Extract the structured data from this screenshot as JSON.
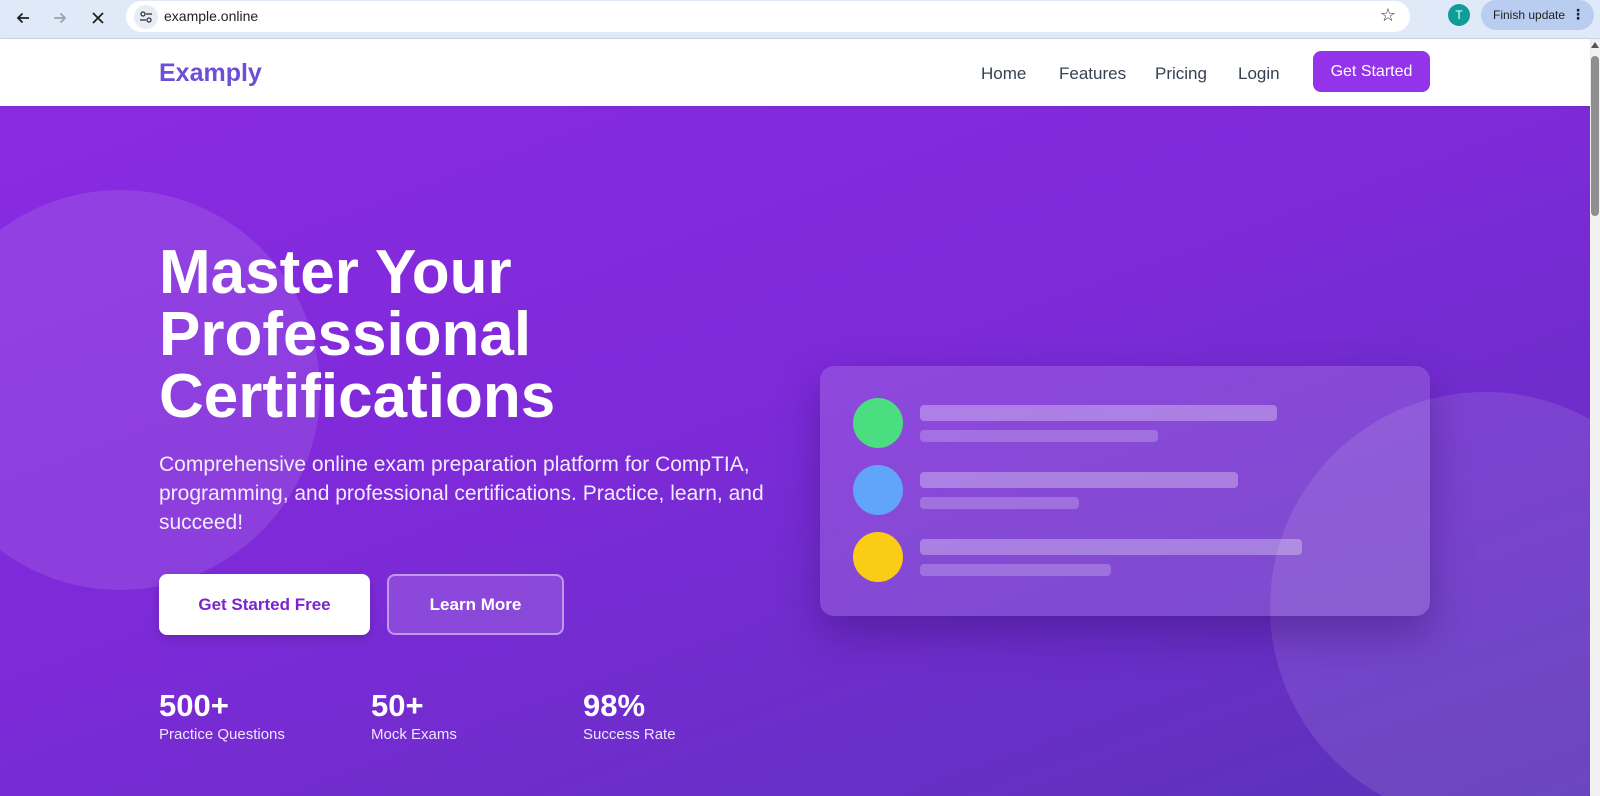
{
  "browser": {
    "url": "example.online",
    "profile_initial": "T",
    "update_label": "Finish update",
    "icons": [
      "back-arrow-icon",
      "forward-arrow-icon",
      "close-icon",
      "site-info-icon",
      "star-icon",
      "more-vert-icon"
    ]
  },
  "header": {
    "brand": "Examply",
    "nav": [
      {
        "label": "Home"
      },
      {
        "label": "Features"
      },
      {
        "label": "Pricing"
      },
      {
        "label": "Login"
      }
    ],
    "cta_label": "Get Started",
    "colors": {
      "brand": "#6b4fd6",
      "accent": "#9333ea"
    }
  },
  "hero": {
    "title_lines": [
      "Master Your",
      "Professional",
      "Certifications"
    ],
    "description": "Comprehensive online exam preparation platform for CompTIA, programming, and professional certifications. Practice, learn, and succeed!",
    "primary_button": "Get Started Free",
    "secondary_button": "Learn More",
    "stats": [
      {
        "value": "500+",
        "label": "Practice Questions"
      },
      {
        "value": "50+",
        "label": "Mock Exams"
      },
      {
        "value": "98%",
        "label": "Success Rate"
      }
    ],
    "preview_dots": [
      {
        "color": "#4ade80"
      },
      {
        "color": "#60a5fa"
      },
      {
        "color": "#facc15"
      }
    ],
    "background_colors": [
      "#8a2be2",
      "#5a33b8"
    ]
  }
}
